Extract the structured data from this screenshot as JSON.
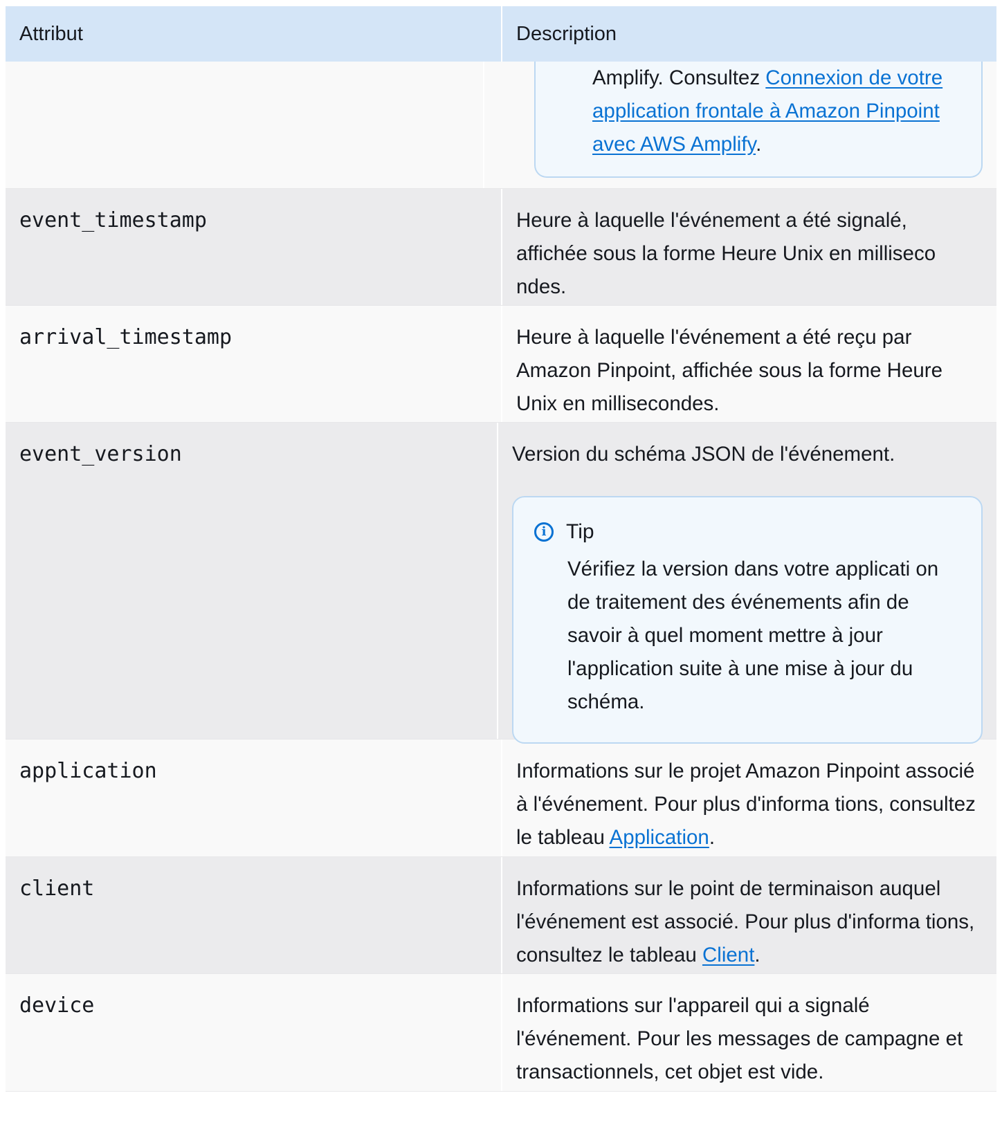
{
  "table": {
    "headers": {
      "attribute": "Attribut",
      "description": "Description"
    },
    "continued_note": {
      "prefix": "Amplify. Consultez ",
      "link_text": "Connexion de votre application frontale à Amazon Pinpoint avec AWS Amplify",
      "suffix": "."
    },
    "rows": [
      {
        "attribute": "event_timestamp",
        "description": "Heure à laquelle l'événement a été signalé, affichée sous la forme Heure Unix en milliseco ndes."
      },
      {
        "attribute": "arrival_timestamp",
        "description": "Heure à laquelle l'événement a été reçu par Amazon Pinpoint, affichée sous la forme Heure Unix en millisecondes."
      },
      {
        "attribute": "event_version",
        "description": "Version du schéma JSON de l'événement.",
        "tip": {
          "label": "Tip",
          "text": "Vérifiez la version dans votre applicati on de traitement des événements afin de savoir à quel moment mettre à jour l'application suite à une mise à jour du schéma."
        }
      },
      {
        "attribute": "application",
        "description_prefix": "Informations sur le projet Amazon Pinpoint associé à l'événement. Pour plus d'informa tions, consultez le tableau ",
        "link_text": "Application",
        "suffix": "."
      },
      {
        "attribute": "client",
        "description_prefix": "Informations sur le point de terminaison auquel l'événement est associé. Pour plus d'informa tions, consultez le tableau ",
        "link_text": "Client",
        "suffix": "."
      },
      {
        "attribute": "device",
        "description": "Informations sur l'appareil qui a signalé l'événement. Pour les messages de campagne et transactionnels, cet objet est vide."
      }
    ]
  }
}
